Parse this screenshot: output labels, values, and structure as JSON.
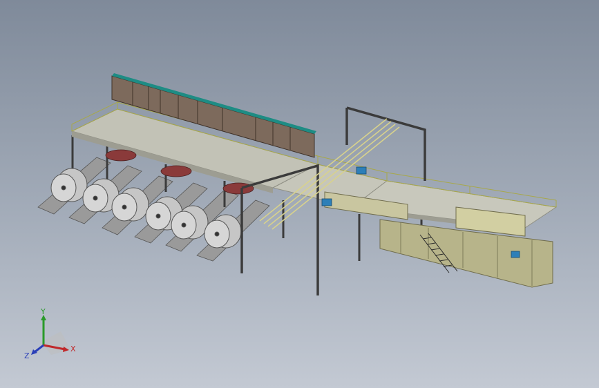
{
  "viewport": {
    "background_top": "#7f8a9a",
    "background_bottom": "#c3c9d3"
  },
  "colors": {
    "deck": "#c2c2b6",
    "deck_edge": "#8f8f84",
    "frame_steel": "#3b3b3b",
    "cabinet": "#7d6a5c",
    "cabinet_top": "#1e8c84",
    "roll": "#d6d6d6",
    "rail_yellow": "#d8d28c",
    "machine_khaki": "#b7b48a",
    "motor_blue": "#2d7fb8",
    "accent_red": "#8a3a3a"
  },
  "triad": {
    "x_label": "X",
    "y_label": "Y",
    "z_label": "Z",
    "x_color": "#c0282a",
    "y_color": "#2a9a2a",
    "z_color": "#2a3fb8"
  }
}
